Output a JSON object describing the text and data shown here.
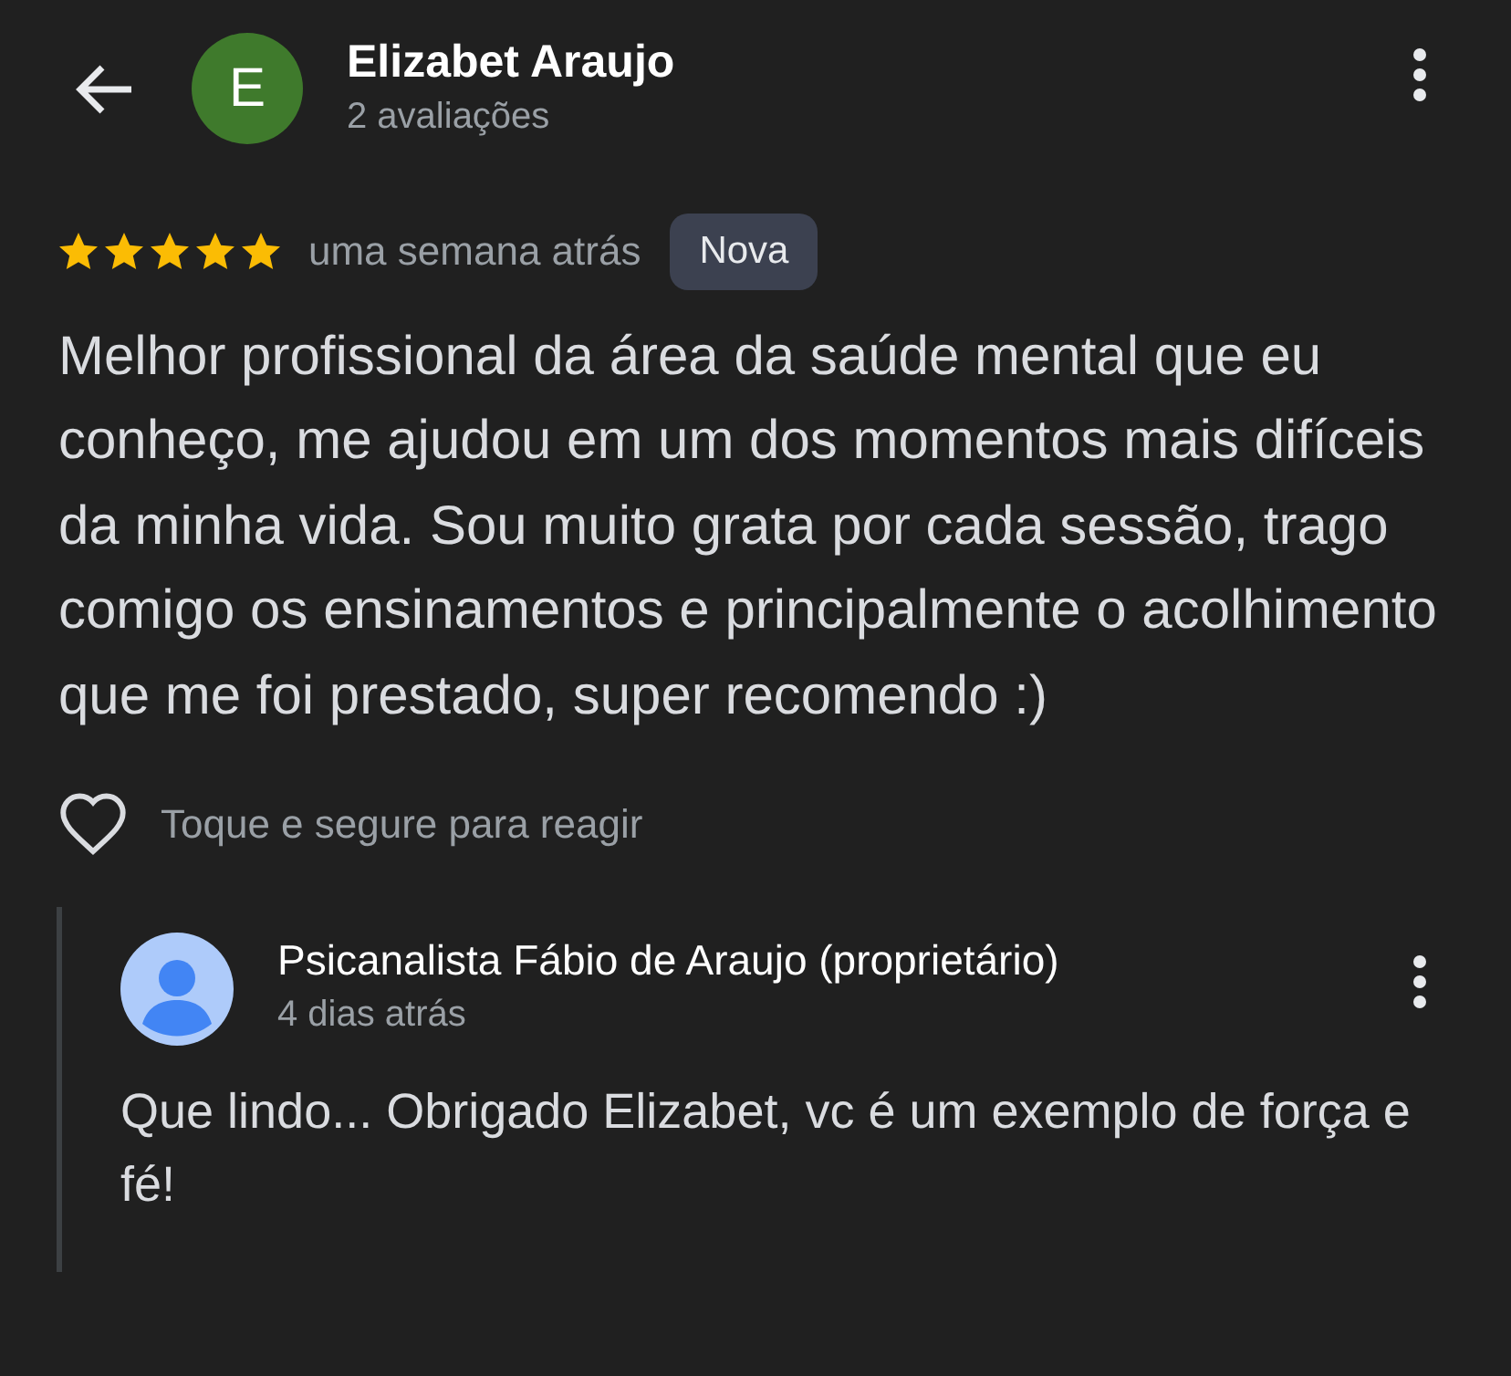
{
  "reviewer": {
    "initial": "E",
    "name": "Elizabet Araujo",
    "meta": "2 avaliações"
  },
  "review": {
    "stars": 5,
    "time": "uma semana atrás",
    "badge": "Nova",
    "text": "Melhor profissional da área da saúde mental que eu conheço, me ajudou em um dos momentos mais difíceis da minha vida. Sou muito grata por cada sessão, trago comigo os ensinamentos e principalmente o acolhimento que me foi prestado, super recomendo :)"
  },
  "reaction": {
    "hint": "Toque e segure para reagir"
  },
  "reply": {
    "name": "Psicanalista Fábio de Araujo (proprietário)",
    "time": "4 dias atrás",
    "text": "Que lindo... Obrigado Elizabet, vc é um exemplo de força e fé!"
  }
}
